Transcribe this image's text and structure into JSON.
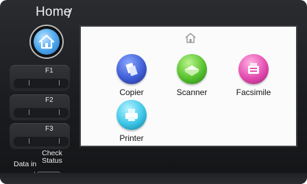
{
  "header": {
    "title": "Home"
  },
  "left_panel": {
    "home_button": {
      "icon": "home-icon"
    },
    "function_keys": [
      {
        "label": "F1"
      },
      {
        "label": "F2"
      },
      {
        "label": "F3"
      }
    ],
    "check_status": {
      "label": "Check Status",
      "icon": "check-status-icon"
    },
    "data_in": {
      "label": "Data in",
      "icon": "data-in-icon"
    }
  },
  "screen": {
    "home_icon": "home-icon",
    "apps": [
      {
        "label": "Copier",
        "icon": "copier-icon",
        "color": "#3f5fd6"
      },
      {
        "label": "Scanner",
        "icon": "scanner-icon",
        "color": "#58c22f"
      },
      {
        "label": "Facsimile",
        "icon": "facsimile-icon",
        "color": "#e44bb0"
      },
      {
        "label": "Printer",
        "icon": "printer-icon",
        "color": "#3cc6e7"
      }
    ]
  },
  "bottom_bar": {
    "labels": [
      "",
      ""
    ]
  }
}
